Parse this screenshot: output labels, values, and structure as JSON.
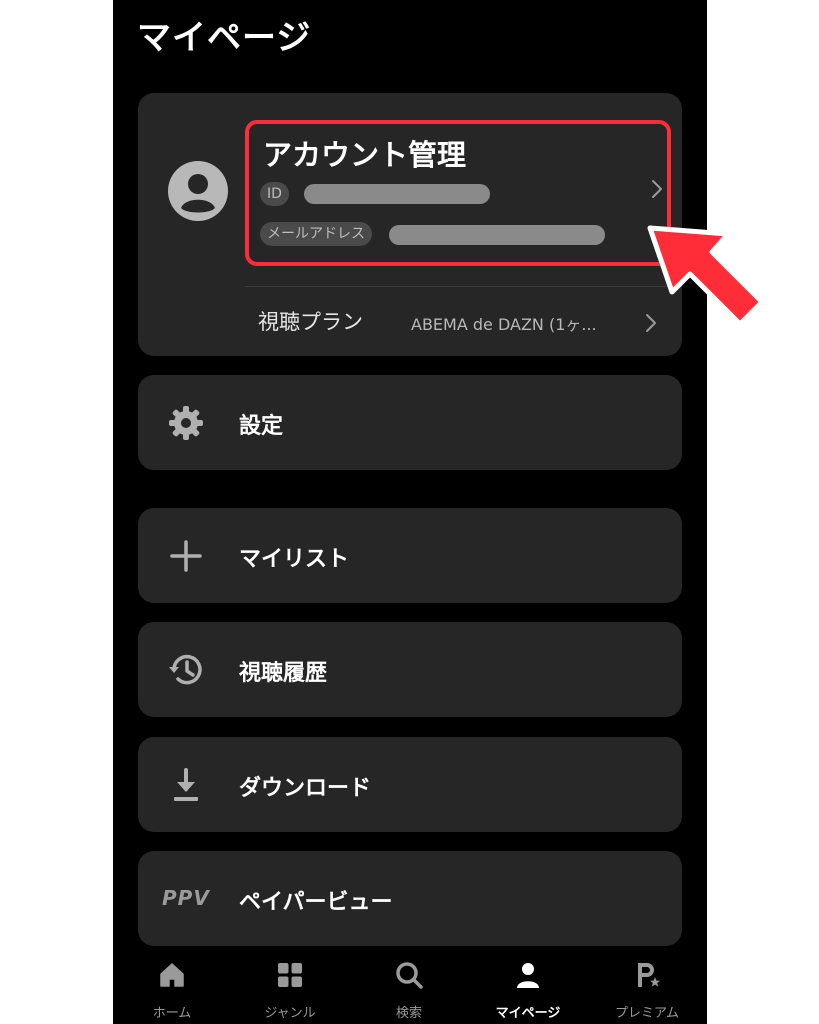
{
  "header": {
    "title": "マイページ"
  },
  "account": {
    "title": "アカウント管理",
    "id_badge": "ID",
    "mail_badge": "メールアドレス",
    "plan_label": "視聴プラン",
    "plan_value": "ABEMA de DAZN (1ヶ..."
  },
  "menu": {
    "settings": "設定",
    "mylist": "マイリスト",
    "history": "視聴履歴",
    "download": "ダウンロード",
    "ppv_badge": "PPV",
    "ppv": "ペイパービュー"
  },
  "tabs": [
    {
      "label": "ホーム",
      "icon": "home-icon"
    },
    {
      "label": "ジャンル",
      "icon": "grid-icon"
    },
    {
      "label": "検索",
      "icon": "search-icon"
    },
    {
      "label": "マイページ",
      "icon": "person-icon",
      "active": true
    },
    {
      "label": "プレミアム",
      "icon": "premium-icon"
    }
  ],
  "colors": {
    "background": "#000000",
    "card": "#262626",
    "highlight": "#ff2d37",
    "inactive_text": "#9a9a9a"
  }
}
